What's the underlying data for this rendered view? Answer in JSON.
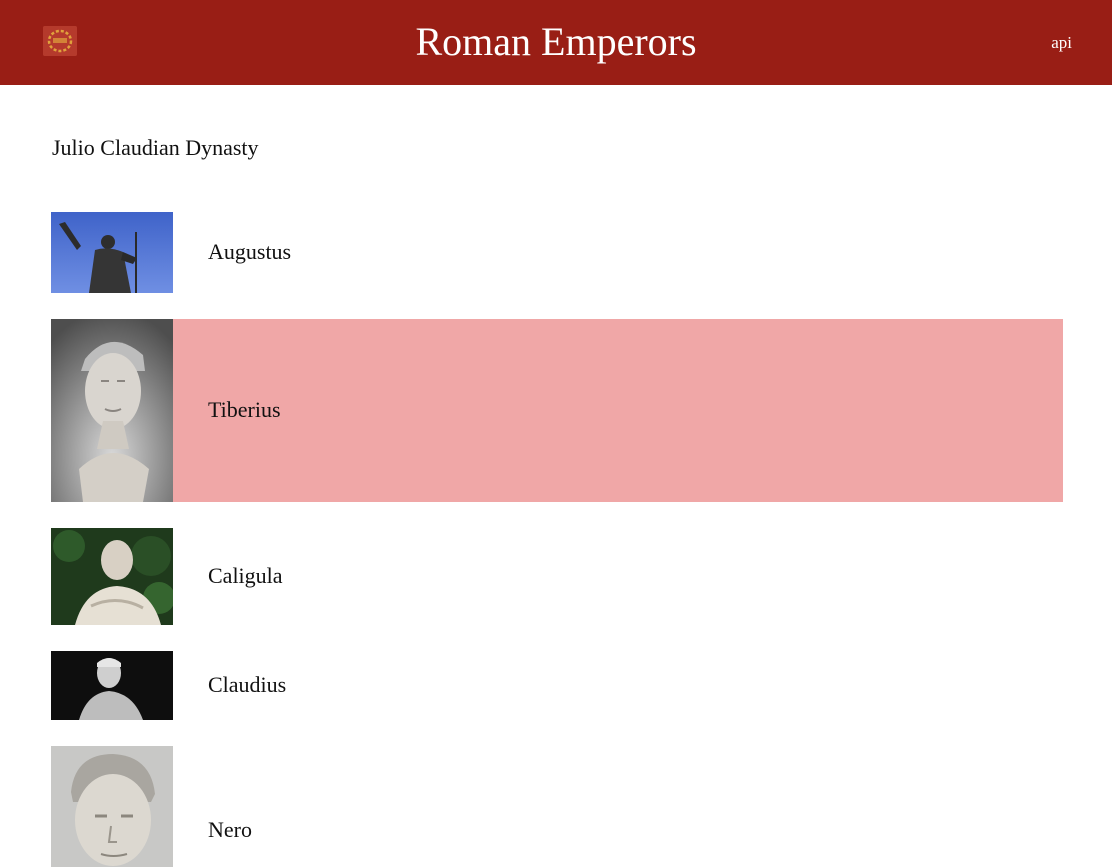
{
  "header": {
    "title": "Roman Emperors",
    "api_link": "api",
    "logo_icon": "laurel-wreath-icon",
    "background": "#991e15"
  },
  "main": {
    "dynasty_heading": "Julio Claudian Dynasty",
    "selected_color": "#f0a7a7",
    "emperors": [
      {
        "name": "Augustus",
        "selected": false
      },
      {
        "name": "Tiberius",
        "selected": true
      },
      {
        "name": "Caligula",
        "selected": false
      },
      {
        "name": "Claudius",
        "selected": false
      },
      {
        "name": "Nero",
        "selected": false
      }
    ]
  }
}
